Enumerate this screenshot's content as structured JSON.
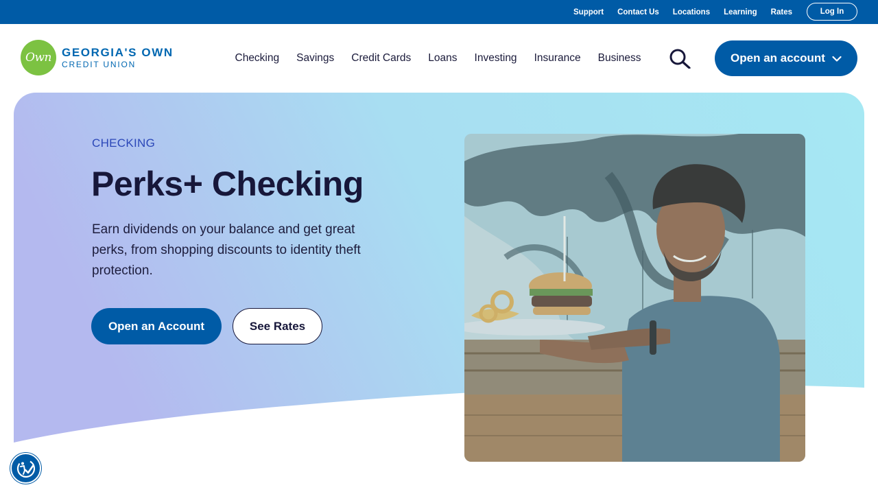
{
  "utility": {
    "links": [
      "Support",
      "Contact Us",
      "Locations",
      "Learning",
      "Rates"
    ],
    "login_label": "Log In"
  },
  "logo": {
    "mark_text": "Own",
    "line1": "GEORGIA'S OWN",
    "line2": "CREDIT UNION",
    "brand_green": "#7cc242",
    "brand_blue": "#0067b1"
  },
  "nav": {
    "items": [
      "Checking",
      "Savings",
      "Credit Cards",
      "Loans",
      "Investing",
      "Insurance",
      "Business"
    ],
    "search_icon": "search-icon",
    "open_account_label": "Open an account",
    "open_account_icon": "chevron-down-icon"
  },
  "hero": {
    "eyebrow": "CHECKING",
    "title": "Perks+ Checking",
    "description": "Earn dividends on your balance and get great perks, from shopping discounts to identity theft protection.",
    "primary_cta": "Open an Account",
    "secondary_cta": "See Rates",
    "photo_alt": "man-serving-burger-photo"
  },
  "accessibility": {
    "icon": "accessibility-icon"
  },
  "colors": {
    "primary": "#005ba6",
    "text_dark": "#17173a",
    "eyebrow": "#2b47b8",
    "gradient_start": "#b4b9ef",
    "gradient_end": "#a6e8f3"
  }
}
